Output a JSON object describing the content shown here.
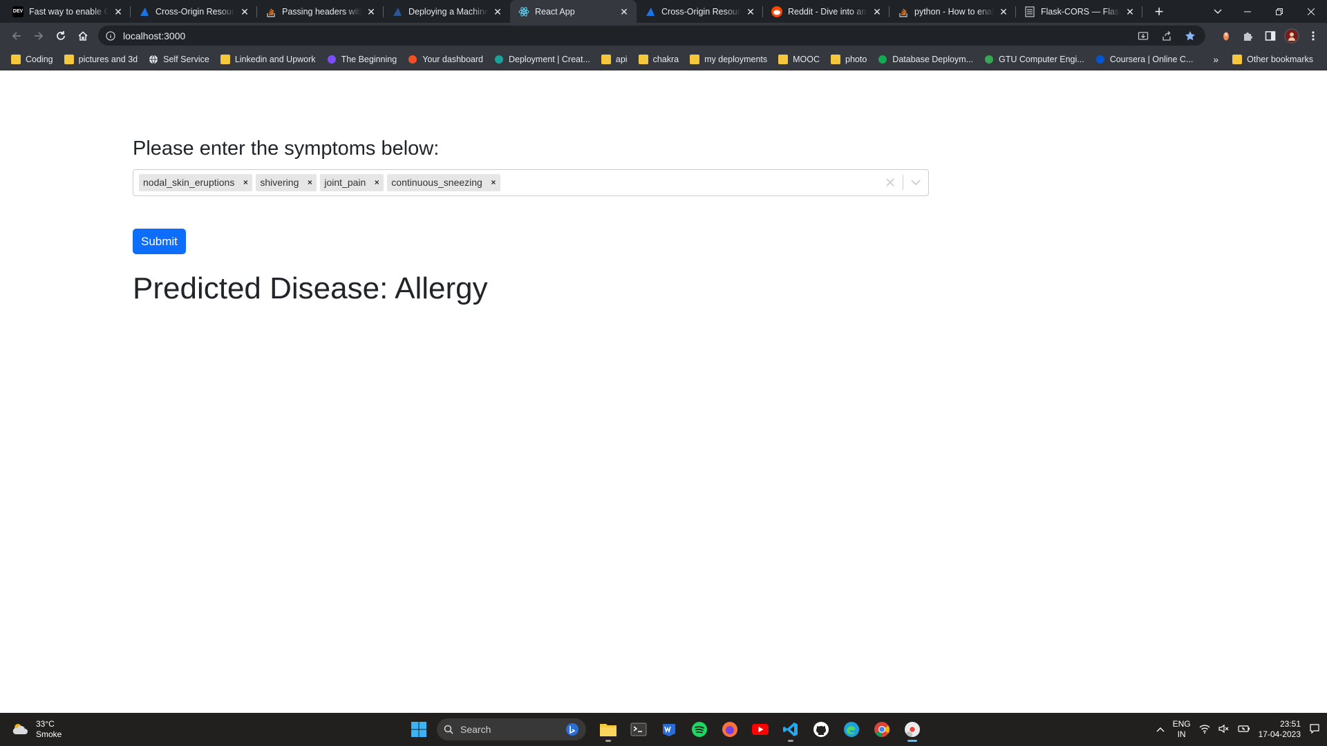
{
  "browser": {
    "tabs": [
      {
        "title": "Fast way to enable CORS",
        "favicon": "dev-icon",
        "color": "#000000",
        "active": false
      },
      {
        "title": "Cross-Origin Resource Sharing",
        "favicon": "cross-origin-icon",
        "color": "#1a73e8",
        "active": false
      },
      {
        "title": "Passing headers with axios",
        "favicon": "stackoverflow-icon",
        "color": "#f48024",
        "active": false
      },
      {
        "title": "Deploying a Machine Learning",
        "favicon": "site-icon",
        "color": "#2b5797",
        "active": false
      },
      {
        "title": "React App",
        "favicon": "react-icon",
        "color": "#61dafb",
        "active": true
      },
      {
        "title": "Cross-Origin Resource Sharing",
        "favicon": "cross-origin-icon",
        "color": "#1a73e8",
        "active": false
      },
      {
        "title": "Reddit - Dive into anything",
        "favicon": "reddit-icon",
        "color": "#ff4500",
        "active": false
      },
      {
        "title": "python - How to enable CORS",
        "favicon": "stackoverflow-icon",
        "color": "#f48024",
        "active": false
      },
      {
        "title": "Flask-CORS — Flask-CORS",
        "favicon": "doc-icon",
        "color": "#9aa0a6",
        "active": false
      }
    ],
    "dev_badge": "DEV",
    "url": "localhost:3000",
    "bookmarks": [
      {
        "label": "Coding",
        "type": "folder"
      },
      {
        "label": "pictures and 3d",
        "type": "folder"
      },
      {
        "label": "Self Service",
        "type": "globe"
      },
      {
        "label": "Linkedin and Upwork",
        "type": "folder"
      },
      {
        "label": "The Beginning",
        "type": "site",
        "color": "#7c4dff"
      },
      {
        "label": "Your dashboard",
        "type": "site",
        "color": "#f25022"
      },
      {
        "label": "Deployment | Creat...",
        "type": "site",
        "color": "#1aa39b"
      },
      {
        "label": "api",
        "type": "folder"
      },
      {
        "label": "chakra",
        "type": "folder"
      },
      {
        "label": "my deployments",
        "type": "folder"
      },
      {
        "label": "MOOC",
        "type": "folder"
      },
      {
        "label": "photo",
        "type": "folder"
      },
      {
        "label": "Database Deploym...",
        "type": "site",
        "color": "#13aa52"
      },
      {
        "label": "GTU Computer Engi...",
        "type": "site",
        "color": "#34a853"
      },
      {
        "label": "Coursera | Online C...",
        "type": "site",
        "color": "#0056d2"
      }
    ],
    "other_bookmarks": "Other bookmarks"
  },
  "app": {
    "prompt": "Please enter the symptoms below:",
    "selected_symptoms": [
      "nodal_skin_eruptions",
      "shivering",
      "joint_pain",
      "continuous_sneezing"
    ],
    "submit_label": "Submit",
    "result": "Predicted Disease: Allergy"
  },
  "taskbar": {
    "weather_temp": "33°C",
    "weather_desc": "Smoke",
    "search_placeholder": "Search",
    "lang_top": "ENG",
    "lang_bottom": "IN",
    "time": "23:51",
    "date": "17-04-2023"
  },
  "colors": {
    "accent": "#0d6efd",
    "chip_bg": "#e6e6e6",
    "tab_active": "#35393f",
    "tab_strip": "#1f2327"
  }
}
